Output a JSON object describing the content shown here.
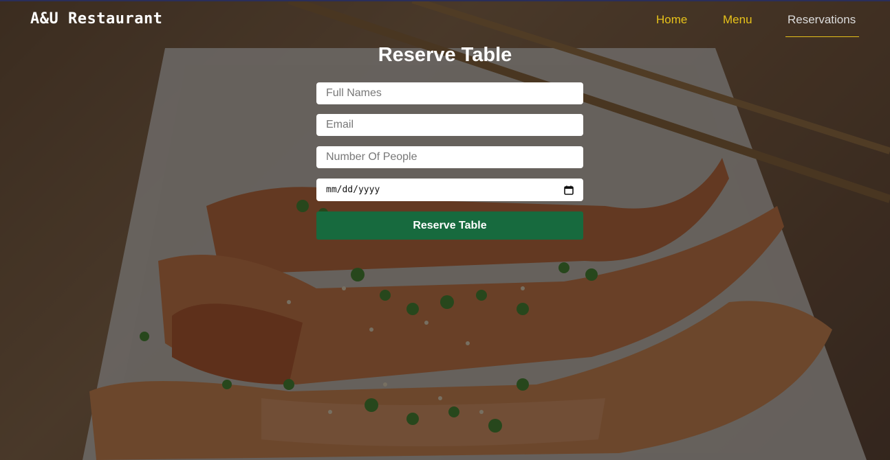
{
  "brand": {
    "name": "A&U Restaurant"
  },
  "nav": {
    "items": [
      {
        "label": "Home"
      },
      {
        "label": "Menu"
      },
      {
        "label": "Reservations"
      }
    ],
    "active": "Reservations",
    "accent_color": "#e7c21a"
  },
  "form": {
    "title": "Reserve Table",
    "full_names_placeholder": "Full Names",
    "email_placeholder": "Email",
    "people_placeholder": "Number Of People",
    "date_placeholder": "mm/dd/yyyy",
    "submit_label": "Reserve Table",
    "submit_color": "#176a3e"
  },
  "icons": {
    "date": "calendar-icon"
  }
}
